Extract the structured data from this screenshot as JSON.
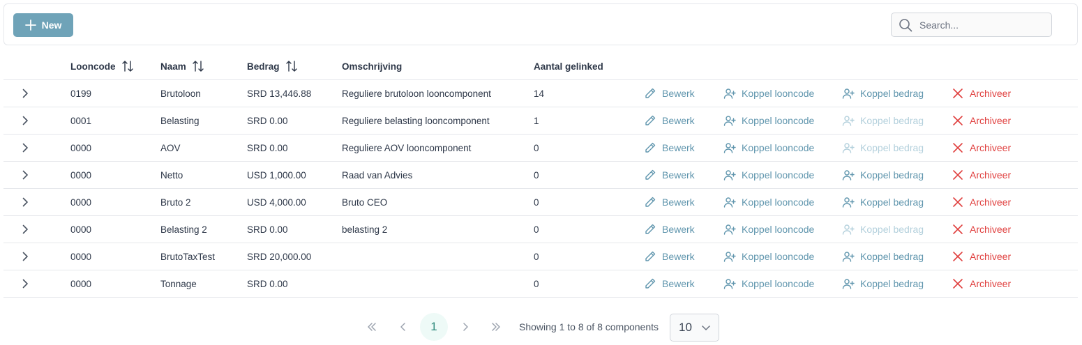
{
  "toolbar": {
    "new_label": "New",
    "search_placeholder": "Search..."
  },
  "columns": [
    "Looncode",
    "Naam",
    "Bedrag",
    "Omschrijving",
    "Aantal gelinked"
  ],
  "actions": {
    "edit": "Bewerk",
    "link_code": "Koppel looncode",
    "link_amount": "Koppel bedrag",
    "archive": "Archiveer"
  },
  "rows": [
    {
      "code": "0199",
      "naam": "Brutoloon",
      "bedrag": "SRD 13,446.88",
      "omschrijving": "Reguliere brutoloon looncomponent",
      "aantal": "14",
      "amount_link_enabled": true
    },
    {
      "code": "0001",
      "naam": "Belasting",
      "bedrag": "SRD 0.00",
      "omschrijving": "Reguliere belasting looncomponent",
      "aantal": "1",
      "amount_link_enabled": false
    },
    {
      "code": "0000",
      "naam": "AOV",
      "bedrag": "SRD 0.00",
      "omschrijving": "Reguliere AOV looncomponent",
      "aantal": "0",
      "amount_link_enabled": false
    },
    {
      "code": "0000",
      "naam": "Netto",
      "bedrag": "USD 1,000.00",
      "omschrijving": "Raad van Advies",
      "aantal": "0",
      "amount_link_enabled": true
    },
    {
      "code": "0000",
      "naam": "Bruto 2",
      "bedrag": "USD 4,000.00",
      "omschrijving": "Bruto CEO",
      "aantal": "0",
      "amount_link_enabled": true
    },
    {
      "code": "0000",
      "naam": "Belasting 2",
      "bedrag": "SRD 0.00",
      "omschrijving": "belasting 2",
      "aantal": "0",
      "amount_link_enabled": false
    },
    {
      "code": "0000",
      "naam": "BrutoTaxTest",
      "bedrag": "SRD 20,000.00",
      "omschrijving": "",
      "aantal": "0",
      "amount_link_enabled": true
    },
    {
      "code": "0000",
      "naam": "Tonnage",
      "bedrag": "SRD 0.00",
      "omschrijving": "",
      "aantal": "0",
      "amount_link_enabled": true
    }
  ],
  "pagination": {
    "current_page": "1",
    "info": "Showing 1 to 8 of 8 components",
    "page_size": "10"
  },
  "colors": {
    "accent": "#6fa3b8",
    "link": "#5f95ad",
    "link_disabled": "#b3d0dc",
    "danger": "#e0403f",
    "current_page_bg": "#eefaf7"
  }
}
